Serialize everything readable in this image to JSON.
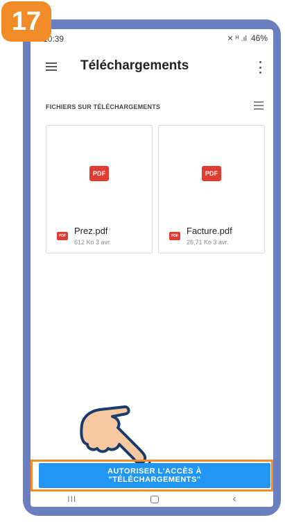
{
  "step_number": "17",
  "status_bar": {
    "time": "10:39",
    "icons": "✕ ᴴ .ıl",
    "battery": "46%"
  },
  "app_bar": {
    "title": "Téléchargements"
  },
  "section": {
    "header": "FICHIERS SUR TÉLÉCHARGEMENTS"
  },
  "files": [
    {
      "name": "Prez.pdf",
      "meta": "612 Ko 3 avr.",
      "type_badge": "PDF"
    },
    {
      "name": "Facture.pdf",
      "meta": "26,71 Ko 3 avr.",
      "type_badge": "PDF"
    }
  ],
  "cta": {
    "line1": "AUTORISER L'ACCÈS À",
    "line2": "\"TÉLÉCHARGEMENTS\""
  },
  "colors": {
    "frame": "#6b7fbf",
    "accent": "#f28c28",
    "button": "#2196f3",
    "pdf": "#e03c31"
  },
  "nav": {
    "recent": "III",
    "back": "‹"
  }
}
